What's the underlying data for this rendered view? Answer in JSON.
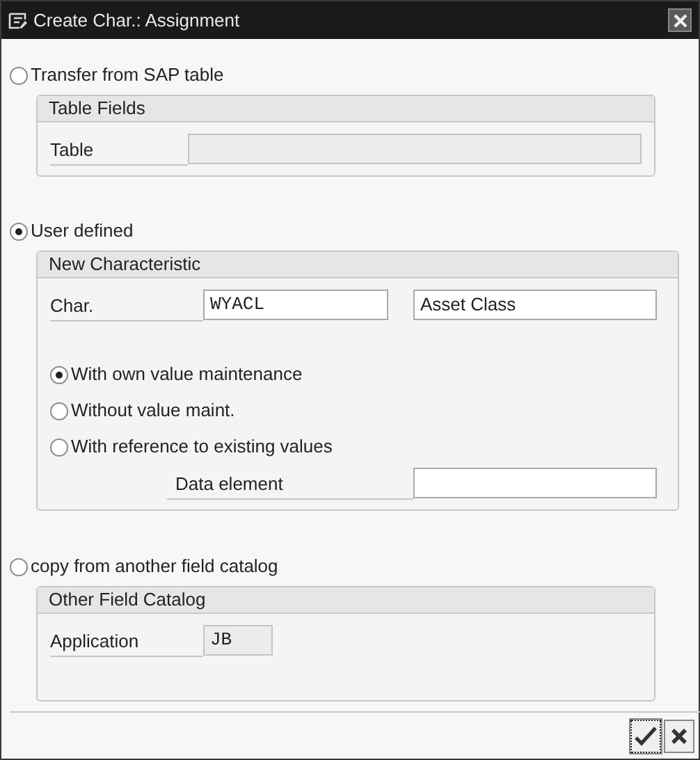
{
  "window": {
    "title": "Create Char.: Assignment"
  },
  "sections": [
    {
      "option": {
        "label": "Transfer from SAP table",
        "selected": false
      },
      "group": {
        "title": "Table Fields",
        "rows": [
          {
            "kind": "field",
            "label": "Table",
            "inputs": [
              {
                "disabled": true
              }
            ]
          }
        ]
      }
    },
    {
      "option": {
        "label": "User defined",
        "selected": true
      },
      "group": {
        "title": "New Characteristic",
        "rows": [
          {
            "kind": "field",
            "label": "Char.",
            "inputs": [
              {
                "value": "WYACL",
                "disabled": false,
                "mono": true
              },
              {
                "value": "Asset Class",
                "disabled": false
              }
            ]
          },
          {
            "kind": "spacer"
          },
          {
            "kind": "radio",
            "label": "With own value maintenance",
            "selected": true
          },
          {
            "kind": "radio",
            "label": "Without value maint.",
            "selected": false
          },
          {
            "kind": "radio",
            "label": "With reference to existing values",
            "selected": false
          },
          {
            "kind": "subfield",
            "label": "Data element",
            "inputs": [
              {
                "disabled": false
              }
            ]
          }
        ]
      }
    },
    {
      "option": {
        "label": "copy from another field catalog",
        "selected": false
      },
      "group": {
        "title": "Other Field Catalog",
        "rows": [
          {
            "kind": "field",
            "label": "Application",
            "inputs": [
              {
                "value": "JB",
                "disabled": true,
                "mono": true
              }
            ]
          },
          {
            "kind": "spacer"
          }
        ]
      }
    }
  ],
  "buttons": [
    {
      "kind": "confirm",
      "focused": true
    },
    {
      "kind": "cancel",
      "focused": false
    }
  ]
}
